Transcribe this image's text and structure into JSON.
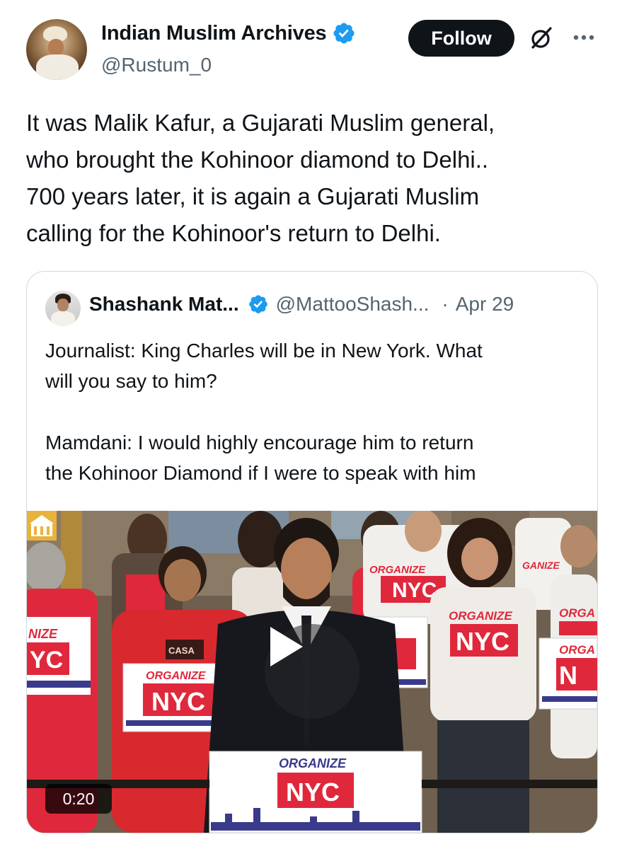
{
  "author": {
    "display_name": "Indian Muslim Archives",
    "handle": "@Rustum_0",
    "verified_icon": "verified-badge-icon",
    "avatar": "avatar"
  },
  "actions": {
    "follow_label": "Follow",
    "grok_icon": "grok-icon",
    "more_icon": "more-options-icon"
  },
  "tweet": {
    "lines": [
      "It was Malik Kafur, a Gujarati Muslim general,",
      "who brought the Kohinoor diamond to Delhi..",
      "700 years later, it is again a Gujarati Muslim",
      "calling for the Kohinoor's return to Delhi."
    ]
  },
  "quote": {
    "display_name": "Shashank Mat...",
    "handle": "@MattooShash...",
    "separator": "·",
    "date": "Apr 29",
    "paragraph1": [
      "Journalist: King Charles will be in New York. What",
      "will you say to him?"
    ],
    "paragraph2": [
      "Mamdani: I would highly encourage him to return",
      "the Kohinoor Diamond if I were to speak with him"
    ]
  },
  "video": {
    "duration": "0:20",
    "play_icon": "play-icon",
    "podium_line1": "ORGANIZE",
    "podium_line2": "NYC",
    "sign_line1": "ORGANIZE",
    "sign_line2": "NYC",
    "shirt_line1": "ORGANIZE",
    "shirt_line2": "NYC",
    "badge_text": "CASA",
    "shirt_partial_1": "NIZE",
    "shirt_partial_2": "YC",
    "shirt_partial_3": "GANIZE",
    "shirt_partial_4": "ORGA",
    "shirt_partial_5": "NY",
    "shirt_partial_6": "ZE",
    "sign_partial_1": "ORGA",
    "sign_partial_2": "N"
  },
  "colors": {
    "text": "#0f1419",
    "secondary": "#536471",
    "verified_blue": "#1d9bf0",
    "organize_red": "#e0283c",
    "skyline_blue": "#3a3a8c"
  }
}
